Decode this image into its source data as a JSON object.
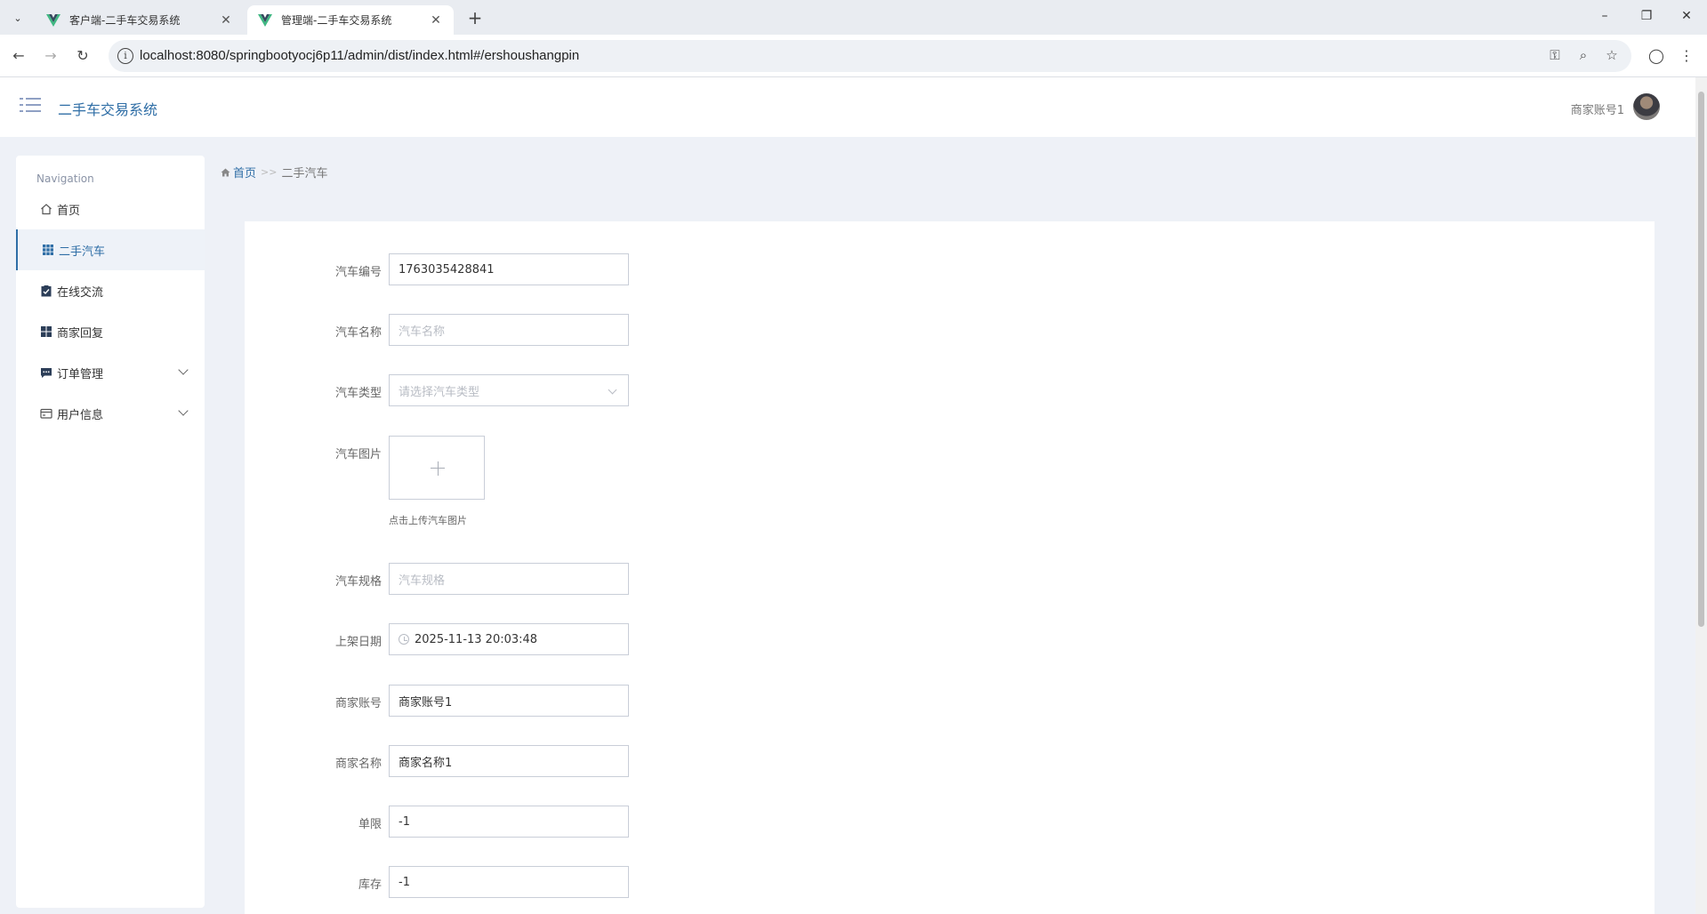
{
  "browser": {
    "tabs": [
      {
        "title": "客户端-二手车交易系统",
        "active": false
      },
      {
        "title": "管理端-二手车交易系统",
        "active": true
      }
    ],
    "url": "localhost:8080/springbootyocj6p11/admin/dist/index.html#/ershoushangpin"
  },
  "header": {
    "app_name": "二手车交易系统",
    "account": "商家账号1"
  },
  "sidebar": {
    "title": "Navigation",
    "items": [
      {
        "label": "首页",
        "icon": "home-icon"
      },
      {
        "label": "二手汽车",
        "icon": "grid-icon",
        "active": true
      },
      {
        "label": "在线交流",
        "icon": "clipboard-icon"
      },
      {
        "label": "商家回复",
        "icon": "tiles-icon"
      },
      {
        "label": "订单管理",
        "icon": "chat-icon",
        "expandable": true
      },
      {
        "label": "用户信息",
        "icon": "card-icon",
        "expandable": true
      }
    ]
  },
  "breadcrumb": {
    "home": "首页",
    "separator": ">>",
    "current": "二手汽车"
  },
  "form": {
    "car_no": {
      "label": "汽车编号",
      "value": "1763035428841"
    },
    "car_name": {
      "label": "汽车名称",
      "placeholder": "汽车名称"
    },
    "car_type": {
      "label": "汽车类型",
      "placeholder": "请选择汽车类型"
    },
    "car_image": {
      "label": "汽车图片",
      "tip": "点击上传汽车图片"
    },
    "car_spec": {
      "label": "汽车规格",
      "placeholder": "汽车规格"
    },
    "list_date": {
      "label": "上架日期",
      "value": "2025-11-13 20:03:48"
    },
    "merchant_account": {
      "label": "商家账号",
      "value": "商家账号1"
    },
    "merchant_name": {
      "label": "商家名称",
      "value": "商家名称1"
    },
    "limit": {
      "label": "单限",
      "value": "-1"
    },
    "stock": {
      "label": "库存",
      "value": "-1"
    }
  },
  "colors": {
    "accent": "#2f6ea6",
    "page_bg": "#eef1f7"
  }
}
